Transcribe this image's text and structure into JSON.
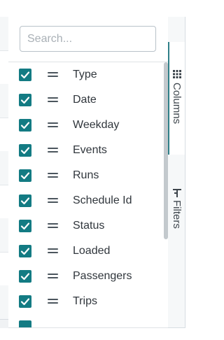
{
  "search": {
    "placeholder": "Search..."
  },
  "columns": [
    {
      "label": "Type",
      "checked": true
    },
    {
      "label": "Date",
      "checked": true
    },
    {
      "label": "Weekday",
      "checked": true
    },
    {
      "label": "Events",
      "checked": true
    },
    {
      "label": "Runs",
      "checked": true
    },
    {
      "label": "Schedule Id",
      "checked": true
    },
    {
      "label": "Status",
      "checked": true
    },
    {
      "label": "Loaded",
      "checked": true
    },
    {
      "label": "Passengers",
      "checked": true
    },
    {
      "label": "Trips",
      "checked": true
    }
  ],
  "sidebar": {
    "tabs": [
      {
        "label": "Columns",
        "icon": "grid-icon",
        "active": true
      },
      {
        "label": "Filters",
        "icon": "filter-icon",
        "active": false
      }
    ]
  },
  "colors": {
    "checkbox": "#137b83",
    "accent": "#2f7f88"
  }
}
